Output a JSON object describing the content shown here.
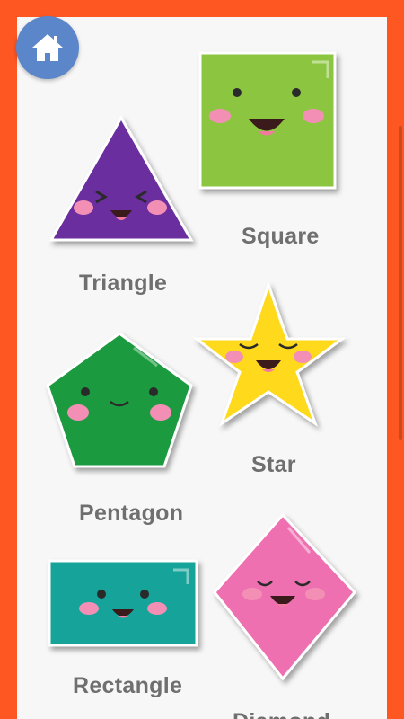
{
  "app": {
    "home_icon": "home-icon",
    "frame_color": "#ff5722",
    "panel_color": "#f7f7f7"
  },
  "shapes": [
    {
      "id": "square",
      "label": "Square",
      "color": "#8cc63f"
    },
    {
      "id": "triangle",
      "label": "Triangle",
      "color": "#6a2f9e"
    },
    {
      "id": "star",
      "label": "Star",
      "color": "#ffd91f"
    },
    {
      "id": "pentagon",
      "label": "Pentagon",
      "color": "#1e9a40"
    },
    {
      "id": "rectangle",
      "label": "Rectangle",
      "color": "#16a39a"
    },
    {
      "id": "diamond",
      "label": "Diamond",
      "color": "#ee6fb0"
    }
  ]
}
